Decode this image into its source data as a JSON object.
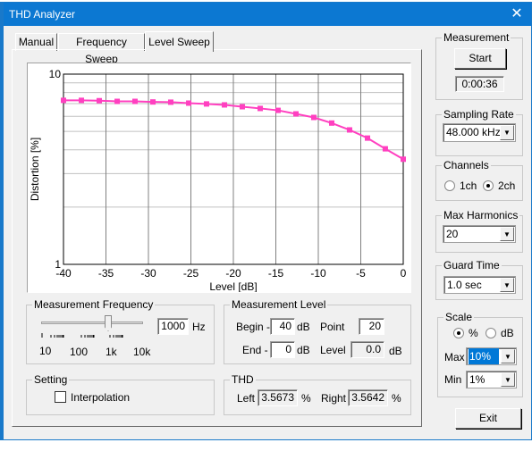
{
  "window": {
    "title": "THD Analyzer",
    "close_icon": "close-icon"
  },
  "tabs": [
    {
      "label": "Manual"
    },
    {
      "label": "Frequency Sweep"
    },
    {
      "label": "Level Sweep",
      "selected": true
    }
  ],
  "chart_data": {
    "type": "line",
    "xlabel": "Level [dB]",
    "ylabel": "Distortion [%]",
    "xlim": [
      -40,
      0
    ],
    "ylim": [
      1,
      10
    ],
    "yscale": "log",
    "grid": true,
    "xticks": [
      "-40",
      "-35",
      "-30",
      "-25",
      "-20",
      "-15",
      "-10",
      "-5",
      "0"
    ],
    "yticks": [
      "1",
      "10"
    ],
    "color": "#ff40c0",
    "marker": "square",
    "x": [
      -40,
      -37.89,
      -35.79,
      -33.68,
      -31.58,
      -29.47,
      -27.37,
      -25.26,
      -23.16,
      -21.05,
      -18.95,
      -16.84,
      -14.74,
      -12.63,
      -10.53,
      -8.42,
      -6.32,
      -4.21,
      -2.11,
      0
    ],
    "y": [
      7.28,
      7.28,
      7.25,
      7.19,
      7.19,
      7.14,
      7.12,
      7.04,
      6.97,
      6.89,
      6.74,
      6.6,
      6.45,
      6.18,
      5.92,
      5.53,
      5.09,
      4.61,
      4.05,
      3.57
    ]
  },
  "freq": {
    "legend": "Measurement Frequency",
    "value": "1000",
    "unit": "Hz",
    "slider_scale": [
      "10",
      "100",
      "1k",
      "10k"
    ]
  },
  "level": {
    "legend": "Measurement Level",
    "begin_label": "Begin -",
    "begin": "40",
    "end_label": "End -",
    "end": "0",
    "db": "dB",
    "point_label": "Point",
    "point": "20",
    "level_label": "Level",
    "level": "0.0"
  },
  "setting": {
    "legend": "Setting",
    "interpolation": "Interpolation",
    "interpolation_checked": false
  },
  "thd": {
    "legend": "THD",
    "left_label": "Left",
    "left": "3.5673",
    "pct": "%",
    "right_label": "Right",
    "right": "3.5642"
  },
  "measurement": {
    "legend": "Measurement",
    "start": "Start",
    "elapsed": "0:00:36"
  },
  "sampling": {
    "legend": "Sampling Rate",
    "value": "48.000 kHz"
  },
  "channels": {
    "legend": "Channels",
    "opt1": "1ch",
    "opt2": "2ch",
    "selected": "2ch"
  },
  "harmonics": {
    "legend": "Max Harmonics",
    "value": "20"
  },
  "guard": {
    "legend": "Guard Time",
    "value": "1.0 sec"
  },
  "scale": {
    "legend": "Scale",
    "pct": "%",
    "db": "dB",
    "selected": "%",
    "max_label": "Max",
    "max": "10%",
    "min_label": "Min",
    "min": "1%",
    "highlight": "#0078d7"
  },
  "exit": "Exit"
}
